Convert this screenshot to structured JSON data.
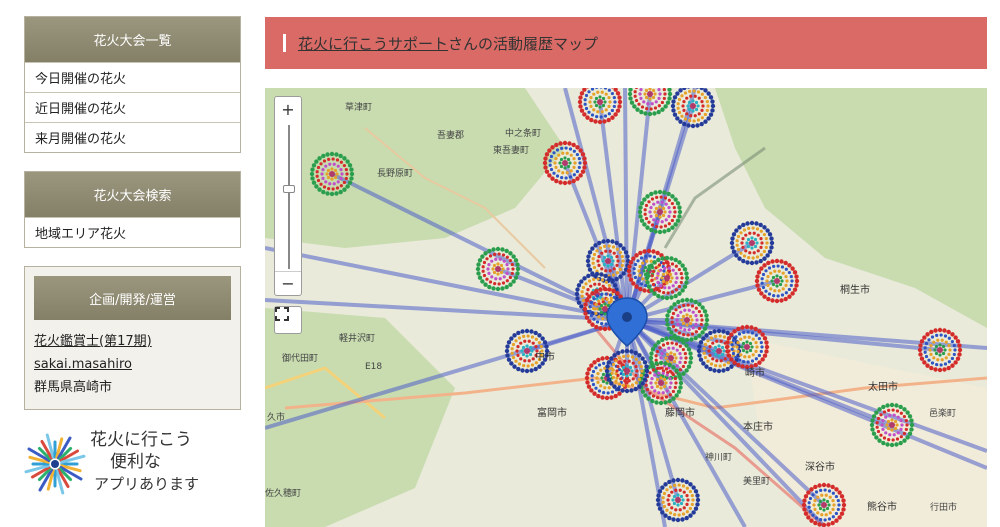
{
  "sidebar": {
    "today_box": {
      "title": "花火大会一覧",
      "items": [
        "今日開催の花火",
        "近日開催の花火",
        "来月開催の花火"
      ]
    },
    "search_box": {
      "title": "花火大会検索",
      "items": [
        "地域エリア花火"
      ]
    },
    "staff_box": {
      "title": "企画/開発/運営",
      "line1": "花火鑑賞士(第17期)",
      "line2": "sakai.masahiro",
      "line3": "群馬県高崎市"
    },
    "promo": {
      "line1": "花火に行こう",
      "line2": "便利な",
      "line3": "アプリあります"
    }
  },
  "banner": {
    "link_text": "花火に行こうサポート",
    "rest_text": "さんの活動履歴マップ"
  },
  "map": {
    "zoom_in": "+",
    "zoom_out": "−",
    "labels": {
      "kusatsu": "草津町",
      "agatsuma": "吾妻郡",
      "nakanojo": "中之条町",
      "higashiagatsuma": "東吾妻町",
      "naganohara": "長野原町",
      "kirifu": "桐生市",
      "karuizawa": "軽井沢町",
      "miyota": "御代田町",
      "annaka": "安中市",
      "tomioka": "富岡市",
      "fujioka": "藤岡市",
      "honjo": "本庄市",
      "ota": "太田市",
      "oizumi": "邑楽町",
      "fukaya": "深谷市",
      "kamikawa": "神川町",
      "misato": "美里町",
      "kumagaya": "熊谷市",
      "gyoda": "行田市",
      "saku": "佐久穂町",
      "kiryu2": "崎市",
      "e18": "E18",
      "shi1": "久市",
      "shi2": "中市",
      "shi3": "市"
    }
  },
  "colors": {
    "banner_bg": "#d96a65",
    "sidebar_header": "#8c8770",
    "route_line": "#4f5fc8",
    "pin": "#2f6fd6"
  }
}
